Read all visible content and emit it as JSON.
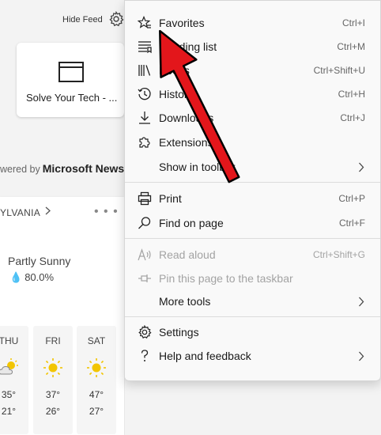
{
  "newtab": {
    "hide_feed": "Hide Feed",
    "tile_label": "Solve Your Tech - ...",
    "powered_prefix": "wered by",
    "powered_brand": "Microsoft News"
  },
  "weather": {
    "location": "YLVANIA",
    "condition": "Partly Sunny",
    "precip": "80.0%",
    "days": [
      {
        "name": "THU",
        "hi": "35°",
        "lo": "21°",
        "icon": "partly-cloudy-icon"
      },
      {
        "name": "FRI",
        "hi": "37°",
        "lo": "26°",
        "icon": "sun-icon"
      },
      {
        "name": "SAT",
        "hi": "47°",
        "lo": "27°",
        "icon": "sun-icon"
      }
    ]
  },
  "menu": {
    "items": [
      {
        "label": "Favorites",
        "shortcut": "Ctrl+I",
        "icon": "favorites-star-icon"
      },
      {
        "label": "Reading list",
        "shortcut": "Ctrl+M",
        "icon": "reading-list-icon"
      },
      {
        "label": "Books",
        "shortcut": "Ctrl+Shift+U",
        "icon": "books-icon"
      },
      {
        "label": "History",
        "shortcut": "Ctrl+H",
        "icon": "history-icon"
      },
      {
        "label": "Downloads",
        "shortcut": "Ctrl+J",
        "icon": "download-icon"
      },
      {
        "label": "Extensions",
        "shortcut": "",
        "icon": "extensions-puzzle-icon"
      },
      {
        "label": "Show in toolbar",
        "shortcut": "",
        "icon": ""
      },
      {
        "label": "Print",
        "shortcut": "Ctrl+P",
        "icon": "printer-icon"
      },
      {
        "label": "Find on page",
        "shortcut": "Ctrl+F",
        "icon": "search-icon"
      },
      {
        "label": "Read aloud",
        "shortcut": "Ctrl+Shift+G",
        "icon": "read-aloud-icon"
      },
      {
        "label": "Pin this page to the taskbar",
        "shortcut": "",
        "icon": "pin-icon"
      },
      {
        "label": "More tools",
        "shortcut": "",
        "icon": ""
      },
      {
        "label": "Settings",
        "shortcut": "",
        "icon": "gear-icon"
      },
      {
        "label": "Help and feedback",
        "shortcut": "",
        "icon": "question-icon"
      }
    ]
  },
  "colors": {
    "accent_arrow": "#e3161b",
    "disabled_text": "#a3a3a3",
    "precip_drop": "#2e7fd3",
    "sun": "#f2c500"
  }
}
